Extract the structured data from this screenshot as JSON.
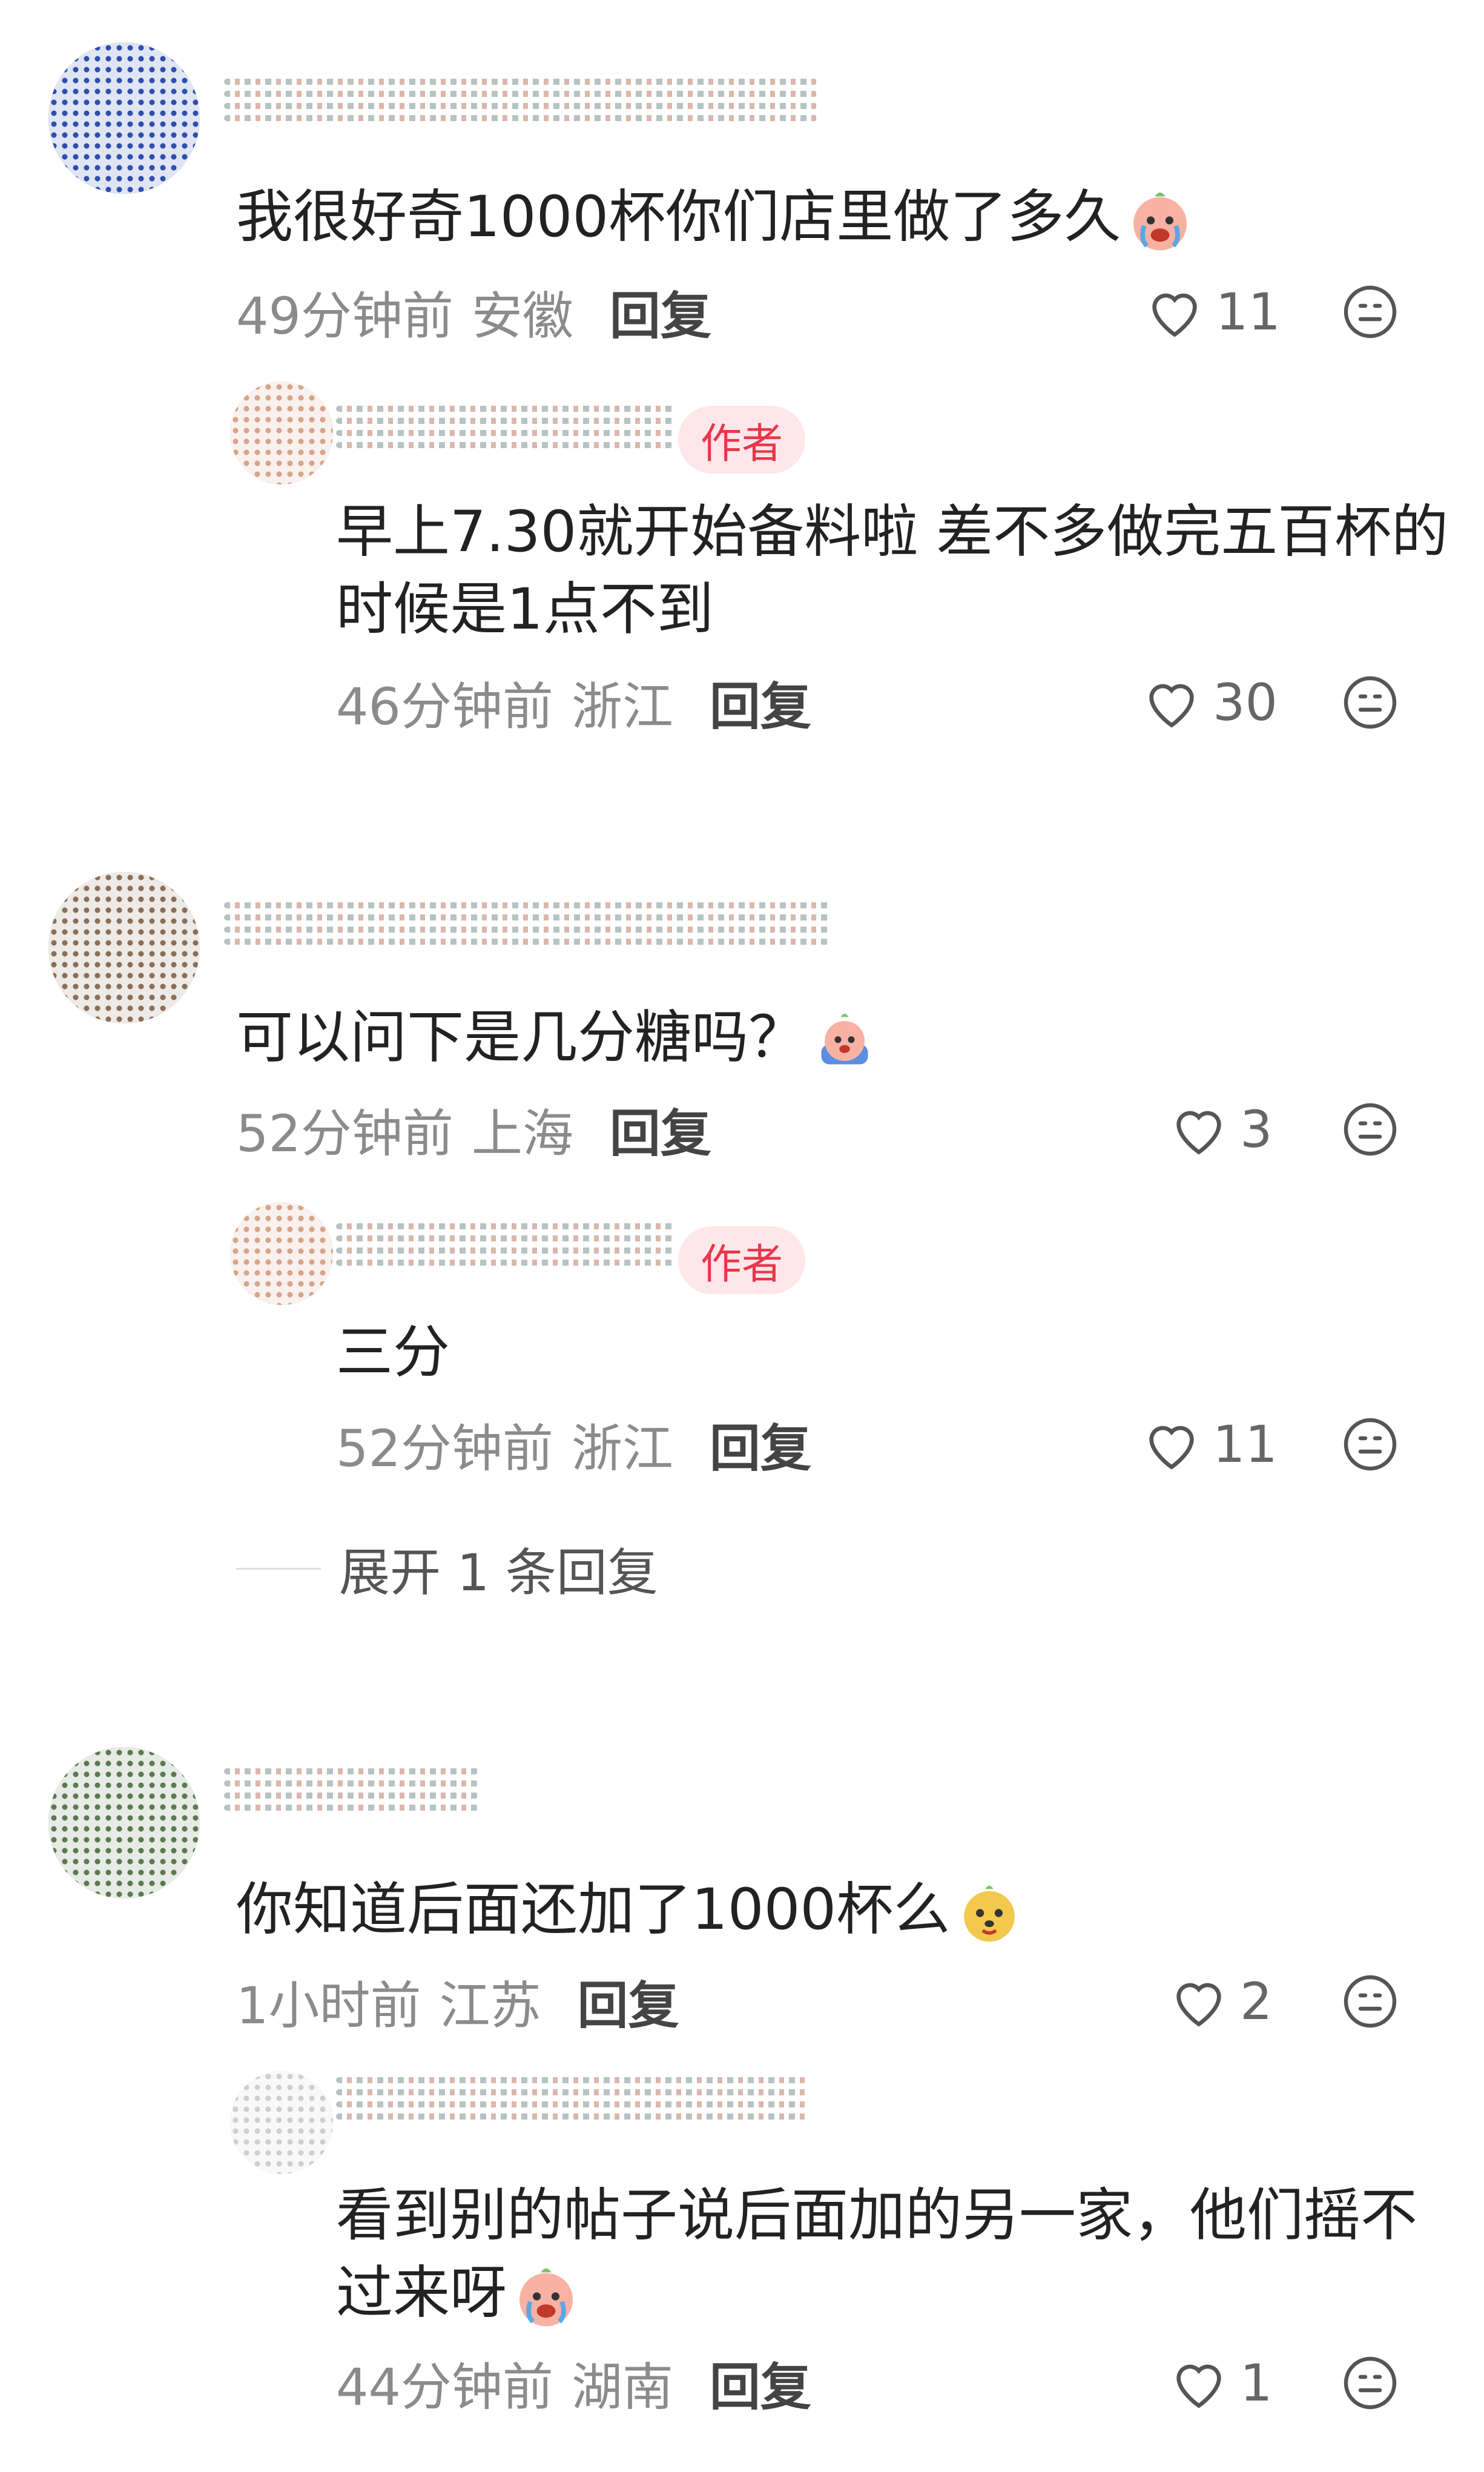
{
  "comments": [
    {
      "text": "我很好奇1000杯你们店里做了多久",
      "time": "49分钟前",
      "region": "安徽",
      "reply_label": "回复",
      "likes": "11",
      "emoji": "crying-peach",
      "replies": [
        {
          "badge": "作者",
          "text_line1": "早上7.30就开始备料啦 差不多做完五百杯的",
          "text_line2": "时候是1点不到",
          "time": "46分钟前",
          "region": "浙江",
          "reply_label": "回复",
          "likes": "30"
        }
      ]
    },
    {
      "text": "可以问下是几分糖吗？",
      "time": "52分钟前",
      "region": "上海",
      "reply_label": "回复",
      "likes": "3",
      "emoji": "crying-blue",
      "replies": [
        {
          "badge": "作者",
          "text_line1": "三分",
          "time": "52分钟前",
          "region": "浙江",
          "reply_label": "回复",
          "likes": "11"
        }
      ],
      "expand_label": "展开 1 条回复"
    },
    {
      "text": "你知道后面还加了1000杯么",
      "time": "1小时前",
      "region": "江苏",
      "reply_label": "回复",
      "likes": "2",
      "emoji": "dog-face",
      "replies": [
        {
          "text_line1": "看到别的帖子说后面加的另一家，他们摇不",
          "text_line2": "过来呀",
          "time": "44分钟前",
          "region": "湖南",
          "reply_label": "回复",
          "likes": "1",
          "emoji": "crying-peach"
        }
      ]
    }
  ],
  "colors": {
    "badge_bg": "#fde7ea",
    "badge_text": "#e8374b",
    "meta_text": "#8b8b8b"
  }
}
